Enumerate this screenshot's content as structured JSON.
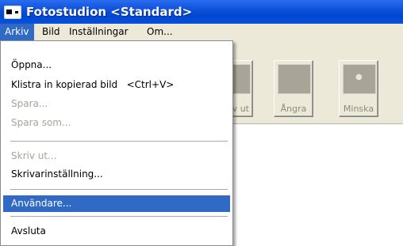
{
  "window": {
    "title": "Fotostudion <Standard>"
  },
  "menubar": {
    "items": [
      {
        "label": "Arkiv"
      },
      {
        "label": "Bild"
      },
      {
        "label": "Inställningar"
      },
      {
        "label": "Om..."
      }
    ]
  },
  "toolbar": {
    "buttons": [
      {
        "label": "v ut"
      },
      {
        "label": "Ångra"
      },
      {
        "label": "Minska"
      }
    ]
  },
  "file_menu": {
    "items": [
      {
        "label": "Öppna...",
        "enabled": true
      },
      {
        "label": "Klistra in kopierad bild   <Ctrl+V>",
        "enabled": true
      },
      {
        "label": "Spara...",
        "enabled": false
      },
      {
        "label": "Spara som...",
        "enabled": false
      },
      {
        "label": "Skriv ut...",
        "enabled": false
      },
      {
        "label": "Skrivarinställning...",
        "enabled": true
      },
      {
        "label": "Användare...",
        "enabled": true,
        "highlighted": true
      },
      {
        "label": "Avsluta",
        "enabled": true
      }
    ]
  },
  "colors": {
    "titlebar": "#0a4fd8",
    "menu_highlight": "#316ac5",
    "menu_background": "#ece9d8",
    "disabled_text": "#a6a49a"
  }
}
